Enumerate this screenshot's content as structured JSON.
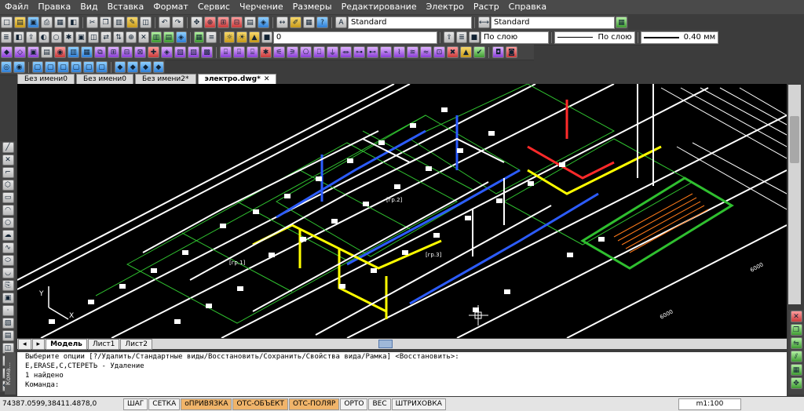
{
  "menu": [
    "Файл",
    "Правка",
    "Вид",
    "Вставка",
    "Формат",
    "Сервис",
    "Черчение",
    "Размеры",
    "Редактирование",
    "Электро",
    "Растр",
    "Справка"
  ],
  "toolbar": {
    "text_style": "Standard",
    "dim_style": "Standard",
    "layer": "0",
    "color": "По слою",
    "linetype": "По слою",
    "lineweight": "0.40 мм"
  },
  "tabs": [
    "Без имени0",
    "Без имени0",
    "Без имени2*",
    "электро.dwg*"
  ],
  "layout_tabs": [
    "Модель",
    "Лист1",
    "Лист2"
  ],
  "command_lines": [
    "Выберите опции [?/Удалить/Стандартные виды/Восстановить/Сохранить/Свойства вида/Рамка] <Восстановить>:",
    "E,ERASE,С,СТЕРЕТЬ - Удаление",
    "1 найдено",
    "Команда:"
  ],
  "command_panel_label": "Кома...",
  "status": {
    "coords": "74387.0599,38411.4878,0",
    "buttons": [
      "ШАГ",
      "СЕТКА",
      "оПРИВЯЗКА",
      "ОТС-ОБЪЕКТ",
      "ОТС-ПОЛЯР",
      "ОРТО",
      "ВЕС",
      "ШТРИХОВКА"
    ],
    "active": [
      "оПРИВЯЗКА",
      "ОТС-ОБЪЕКТ",
      "ОТС-ПОЛЯР"
    ],
    "scale": "m1:100"
  },
  "drawing_labels": [
    "[гр.1]",
    "[гр.2]",
    "[гр.3]",
    "6000",
    "6000"
  ],
  "axis_labels": [
    "Y",
    "X"
  ],
  "colors": {
    "yellow": "#ffff00",
    "blue": "#2c5cff",
    "green": "#2fbf2f",
    "red": "#ff2a2a",
    "white": "#ffffff"
  }
}
